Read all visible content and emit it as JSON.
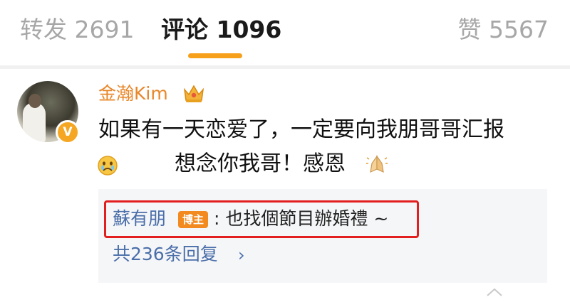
{
  "tabs": {
    "repost_label": "转发 2691",
    "comment_label": "评论 1096",
    "like_label": "赞 5567",
    "active": "comment",
    "accent_color": "#f7a01b"
  },
  "comment": {
    "username": "金瀚Kim",
    "username_color": "#e8872a",
    "avatar": "avatar",
    "verified_badge_text": "V",
    "crown_icon": "crown-icon",
    "line1": "如果有一天恋爱了，一定要向我朋哥哥汇报",
    "line2": "想念你我哥！感恩",
    "emoji_left": "sad-emoji-icon",
    "emoji_right": "pray-emoji-icon"
  },
  "reply": {
    "author": "蘇有朋",
    "author_badge": "博主",
    "text": ": 也找個節目辦婚禮 ~",
    "link_color": "#4a6ea9",
    "highlight_color": "#e21e1e",
    "more_replies": "共236条回复",
    "more_chevron": "›"
  }
}
